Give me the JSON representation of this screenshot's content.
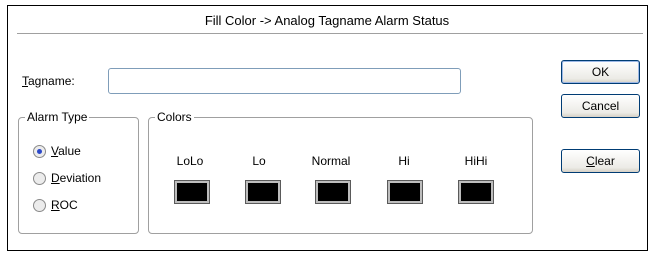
{
  "dialog": {
    "title": "Fill Color -> Analog Tagname Alarm Status"
  },
  "tagname": {
    "label_prefix": "",
    "label_underlined": "T",
    "label_rest": "agname:",
    "value": "",
    "placeholder": ""
  },
  "alarm_type": {
    "legend": "Alarm Type",
    "options": [
      {
        "underlined": "V",
        "rest": "alue",
        "selected": true
      },
      {
        "underlined": "D",
        "rest": "eviation",
        "selected": false
      },
      {
        "underlined": "R",
        "rest": "OC",
        "selected": false
      }
    ]
  },
  "colors": {
    "legend": "Colors",
    "items": [
      {
        "label": "LoLo",
        "color": "#000000"
      },
      {
        "label": "Lo",
        "color": "#000000"
      },
      {
        "label": "Normal",
        "color": "#000000"
      },
      {
        "label": "Hi",
        "color": "#000000"
      },
      {
        "label": "HiHi",
        "color": "#000000"
      }
    ]
  },
  "buttons": {
    "ok": "OK",
    "cancel": "Cancel",
    "clear_underlined": "C",
    "clear_rest": "lear"
  },
  "theme": {
    "accent": "#2b48c8",
    "button_border": "#003c74"
  }
}
